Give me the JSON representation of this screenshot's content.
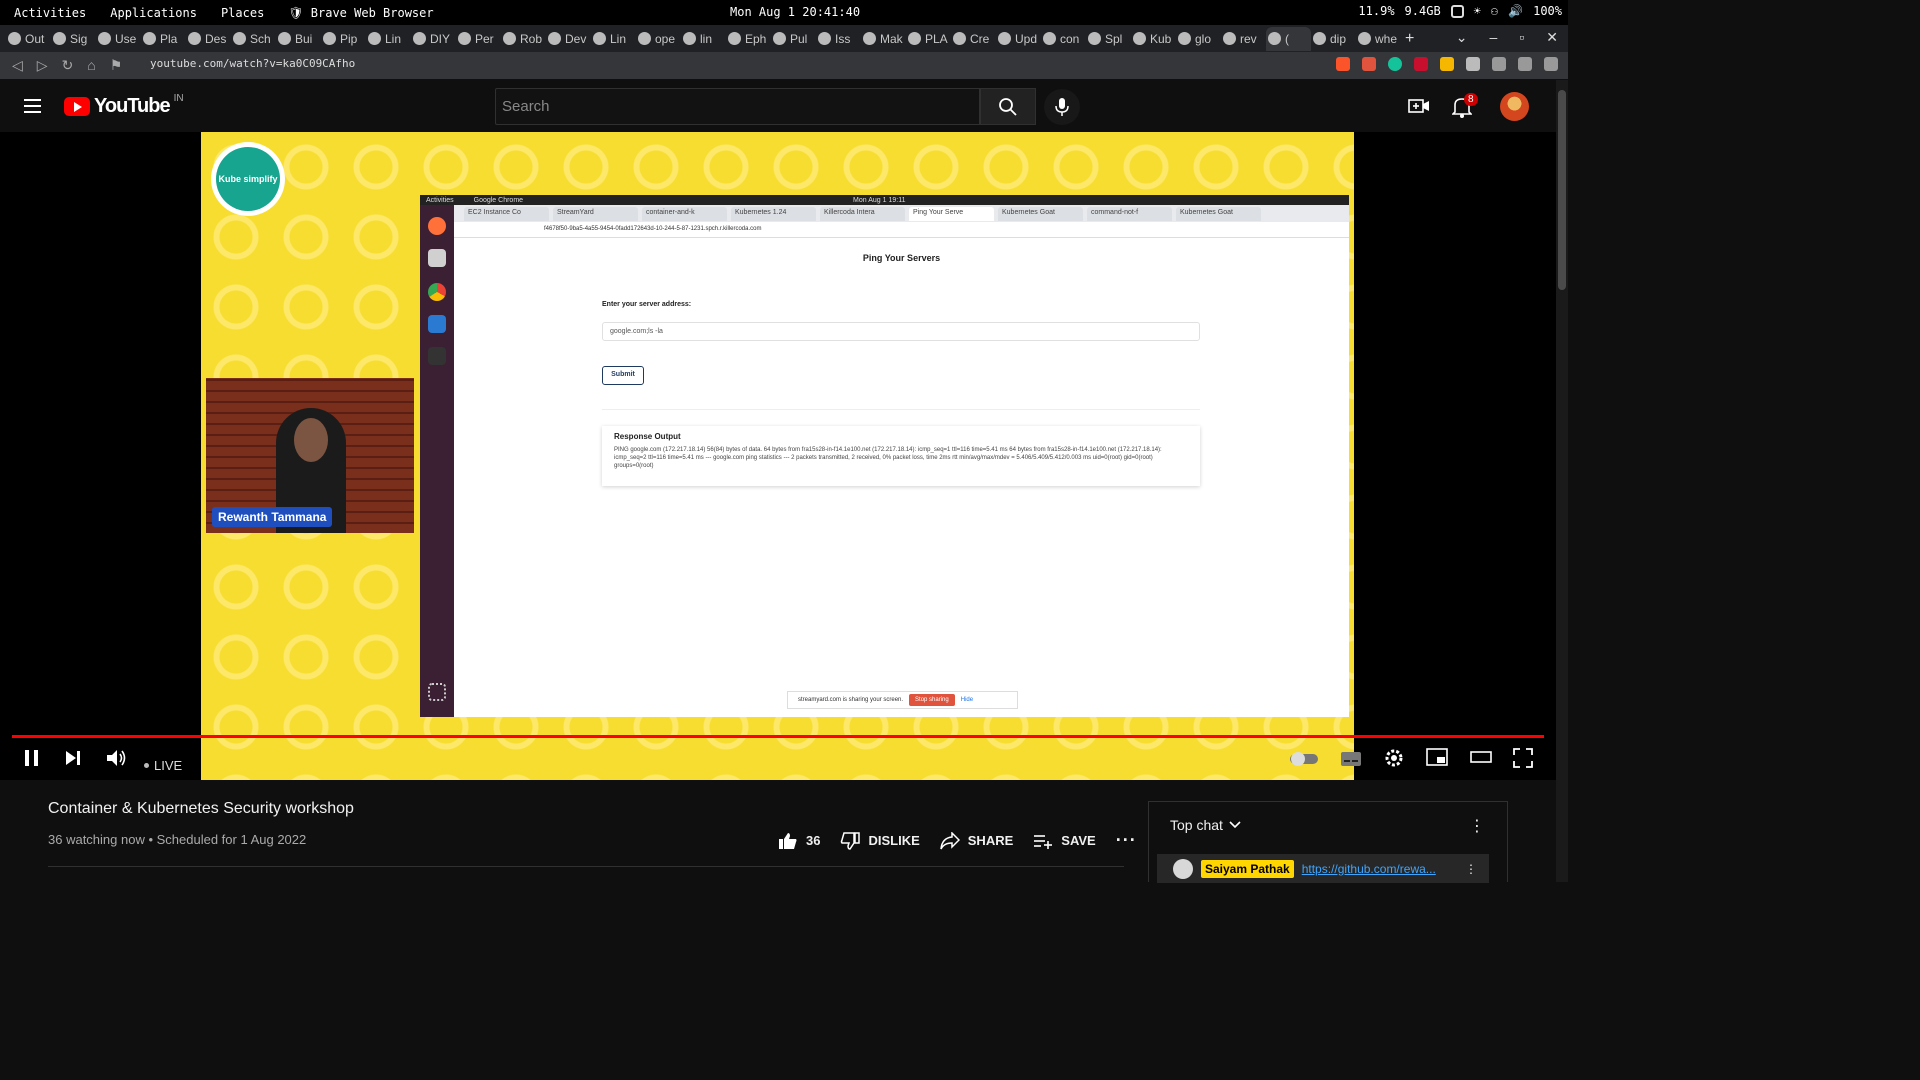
{
  "os_bar": {
    "activities": "Activities",
    "applications": "Applications",
    "places": "Places",
    "app_name": "Brave Web Browser",
    "clock": "Mon Aug 1 20:41:40",
    "cpu": "11.9%",
    "mem": "9.4GB",
    "battery": "100%"
  },
  "tabs": [
    "Out",
    "Sig",
    "Use",
    "Pla",
    "Des",
    "Sch",
    "Bui",
    "Pip",
    "Lin",
    "DIY",
    "Per",
    "Rob",
    "Dev",
    "Lin",
    "ope",
    "lin",
    "Eph",
    "Pul",
    "Iss",
    "Mak",
    "PLA",
    "Cre",
    "Upd",
    "con",
    "Spl",
    "Kub",
    "glo",
    "rev",
    "(",
    "dip",
    "whe"
  ],
  "address": {
    "url": "youtube.com/watch?v=ka0C09CAfho"
  },
  "youtube": {
    "logo": "YouTube",
    "country": "IN",
    "search_placeholder": "Search",
    "notif_count": "8"
  },
  "video": {
    "kube_logo": "Kube simplify",
    "presenter": "Rewanth Tammana",
    "shared_screen": {
      "os_activities": "Activities",
      "os_app": "Google Chrome",
      "os_clock": "Mon Aug 1 19:11",
      "tabs": [
        "EC2 Instance Co",
        "StreamYard",
        "container-and-k",
        "Kubernetes 1.24",
        "Killercoda Intera",
        "Ping Your Serve",
        "Kubernetes Goat",
        "command-not-f",
        "Kubernetes Goat"
      ],
      "url": "f4678f50-9ba5-4a55-9454-0fadd172643d-10-244-5-87-1231.spch.r.killercoda.com",
      "page_title": "Ping Your Servers",
      "input_label": "Enter your server address:",
      "input_value": "google.com;ls -la",
      "submit": "Submit",
      "response_title": "Response Output",
      "response_text": "PING google.com (172.217.18.14) 56(84) bytes of data. 64 bytes from fra15s28-in-f14.1e100.net (172.217.18.14): icmp_seq=1 ttl=116 time=5.41 ms 64 bytes from fra15s28-in-f14.1e100.net (172.217.18.14): icmp_seq=2 ttl=116 time=5.41 ms --- google.com ping statistics --- 2 packets transmitted, 2 received, 0% packet loss, time 2ms rtt min/avg/max/mdev = 5.406/5.409/5.412/0.003 ms uid=0(root) gid=0(root) groups=0(root)",
      "sharing_notice": "streamyard.com is sharing your screen.",
      "stop_sharing": "Stop sharing",
      "hide": "Hide"
    }
  },
  "player_controls": {
    "live": "LIVE"
  },
  "info": {
    "title": "Container & Kubernetes Security workshop",
    "meta": "36 watching now • Scheduled for 1 Aug 2022",
    "likes": "36",
    "dislike": "DISLIKE",
    "share": "SHARE",
    "save": "SAVE"
  },
  "chat": {
    "header": "Top chat",
    "pinned_author": "Saiyam Pathak",
    "pinned_link": "https://github.com/rewa..."
  }
}
